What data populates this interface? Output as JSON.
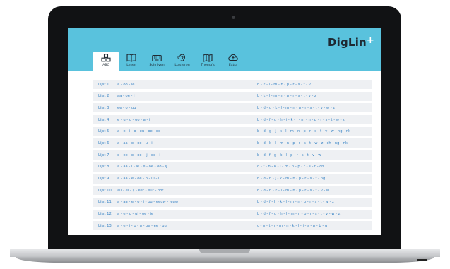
{
  "app": {
    "brand_name": "DigLin",
    "brand_plus": "+",
    "header_color": "#59c2dd",
    "link_color": "#3d86c6"
  },
  "tabs": [
    {
      "label": "ABC",
      "icon": "abc-blocks-icon",
      "active": true
    },
    {
      "label": "Lezen",
      "icon": "book-icon",
      "active": false
    },
    {
      "label": "Schrijven",
      "icon": "keyboard-icon",
      "active": false
    },
    {
      "label": "Luisteren",
      "icon": "ear-icon",
      "active": false
    },
    {
      "label": "Thema's",
      "icon": "map-icon",
      "active": false
    },
    {
      "label": "Extra",
      "icon": "cloud-upload-icon",
      "active": false
    }
  ],
  "lists": [
    {
      "name": "Lijst 1",
      "vowels": "a - oo - ie",
      "consonants": "b - k - l - m - n - p - r - s - t - v"
    },
    {
      "name": "Lijst 2",
      "vowels": "aa - oe - i",
      "consonants": "b - k - l - m - n - p - r - s - t - v - z"
    },
    {
      "name": "Lijst 3",
      "vowels": "ee - o - uu",
      "consonants": "b - d - g - k - l - m - n - p - r - s - t - v - w - z"
    },
    {
      "name": "Lijst 4",
      "vowels": "e - u - o - oo - a - i",
      "consonants": "b - d - f - g - h - j - k - l - m - n - p - r - s - t - w - z"
    },
    {
      "name": "Lijst 5",
      "vowels": "a - e - i - o - eu - oe - oo",
      "consonants": "b - d - g - j - k - l - m - n - p - r - s - t - v - w - ng - nk"
    },
    {
      "name": "Lijst 6",
      "vowels": "a - aa - o - oo - u - i",
      "consonants": "b - d - k - l - m - n - p - r - s - t - w - z - ch - ng - nk"
    },
    {
      "name": "Lijst 7",
      "vowels": "e - ee - o - oo - ij - oe - i",
      "consonants": "b - d - f - g - k - l - p - r - s - t - v - w"
    },
    {
      "name": "Lijst 8",
      "vowels": "a - aa - i - ie - e - oe - oo - ij",
      "consonants": "d - f - h - k - l - m - n - p - r - s - t - ch"
    },
    {
      "name": "Lijst 9",
      "vowels": "a - aa - e - ee - o - ui - i",
      "consonants": "b - d - h - j - k - m - n - p - r - s - t - ng"
    },
    {
      "name": "Lijst 10",
      "vowels": "au - ei - ij - eer - eur - oor",
      "consonants": "b - d - h - k - l - m - n - p - r - s - t - v - w"
    },
    {
      "name": "Lijst 11",
      "vowels": "a - aa - e - o - i - ou - eeuw - ieuw",
      "consonants": "b - d - f - h - k - l - m - n - p - r - s - t - w - z"
    },
    {
      "name": "Lijst 12",
      "vowels": "a - e - o - ui - oe - ie",
      "consonants": "b - d - f - g - h - l - m - n - p - r - s - t - v - w - z"
    },
    {
      "name": "Lijst 13",
      "vowels": "a - e - i - o - u - oe - ee - uu",
      "consonants": "c - n - t - r - m - n - k - l - j - s - p - b - g"
    }
  ]
}
